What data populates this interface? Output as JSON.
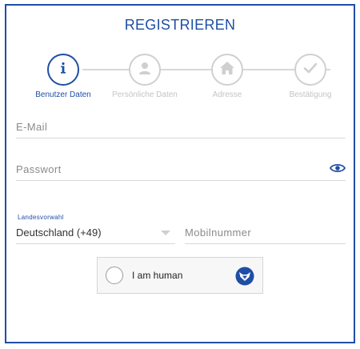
{
  "form": {
    "title": "REGISTRIEREN"
  },
  "steps": [
    {
      "label": "Benutzer Daten",
      "icon": "info-icon",
      "active": true
    },
    {
      "label": "Persönliche Daten",
      "icon": "person-icon",
      "active": false
    },
    {
      "label": "Adresse",
      "icon": "home-icon",
      "active": false
    },
    {
      "label": "Bestätigung",
      "icon": "check-icon",
      "active": false
    }
  ],
  "fields": {
    "email_placeholder": "E-Mail",
    "password_placeholder": "Passwort",
    "country_label": "Landesvorwahl",
    "country_value": "Deutschland (+49)",
    "mobile_placeholder": "Mobilnummer"
  },
  "captcha": {
    "text": "I am human"
  },
  "colors": {
    "accent": "#1f4ea5",
    "inactive": "#d0d0d0",
    "placeholder": "#8a8a8a"
  }
}
